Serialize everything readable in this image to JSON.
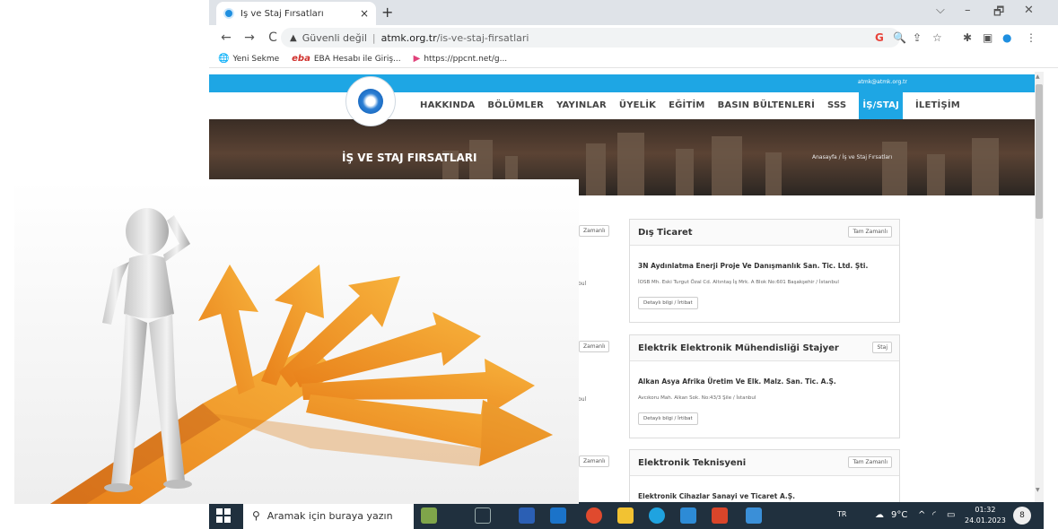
{
  "browser": {
    "tab": {
      "title": "İş ve Staj Fırsatları",
      "close": "×"
    },
    "new_tab": "+",
    "window_controls": [
      "⌵",
      "–",
      "🗗",
      "✕"
    ],
    "nav": {
      "back": "←",
      "forward": "→",
      "reload": "C"
    },
    "omnibox": {
      "security_icon": "warning-triangle-icon",
      "security_text": "Güvenli değil",
      "separator": "|",
      "host": "atmk.org.tr",
      "path": "/is-ve-staj-firsatlari"
    },
    "toolbar_icons": [
      "G",
      "🔍",
      "⇪",
      "☆",
      "✱",
      "▣",
      "●",
      "⋮"
    ],
    "bookmarks": [
      {
        "icon": "globe-icon",
        "label": "Yeni Sekme"
      },
      {
        "icon": "eba-icon",
        "label": "EBA Hesabı ile Giriş..."
      },
      {
        "icon": "ppcnt-icon",
        "label": "https://ppcnt.net/g..."
      }
    ]
  },
  "site": {
    "email": "atmk@atmk.org.tr",
    "nav_items": [
      "HAKKINDA",
      "BÖLÜMLER",
      "YAYINLAR",
      "ÜYELİK",
      "EĞİTİM",
      "BASIN BÜLTENLERİ",
      "SSS",
      "İŞ/STAJ",
      "İLETİŞİM"
    ],
    "active_nav": "İŞ/STAJ",
    "hero_title": "İŞ VE STAJ FIRSATLARI",
    "breadcrumb": "Anasayfa / İş ve Staj Fırsatları",
    "left_badges": [
      "Zamanlı",
      "Zamanlı",
      "Zamanlı"
    ],
    "left_fragments": [
      "bul",
      "bul"
    ],
    "listings": [
      {
        "title": "Dış Ticaret",
        "badge": "Tam Zamanlı",
        "company": "3N Aydınlatma Enerji Proje Ve Danışmanlık San. Tic. Ltd. Şti.",
        "address": "İOSB Mh. Eski Turgut Özal Cd. Altıntaş İş Mrk. A Blok No:601 Başakşehir / İstanbul",
        "button": "Detaylı bilgi / İrtibat"
      },
      {
        "title": "Elektrik Elektronik Mühendisliği Stajyer",
        "badge": "Staj",
        "company": "Alkan Asya Afrika Üretim Ve Elk. Malz. San. Tic. A.Ş.",
        "address": "Avcıkoru Mah. Alkan Sok. No:43/3 Şile / İstanbul",
        "button": "Detaylı bilgi / İrtibat"
      },
      {
        "title": "Elektronik Teknisyeni",
        "badge": "Tam Zamanlı",
        "company": "Elektronik Cihazlar Sanayi ve Ticaret A.Ş.",
        "address": "",
        "button": ""
      }
    ]
  },
  "taskbar": {
    "search_placeholder": "Aramak için buraya yazın",
    "language": "TR",
    "weather": "9°C",
    "time": "01:32",
    "date": "24.01.2023",
    "notification_count": "8"
  },
  "colors": {
    "site_blue": "#1ea6e4",
    "arrow_orange": "#f09a1e",
    "taskbar": "#20303e"
  }
}
